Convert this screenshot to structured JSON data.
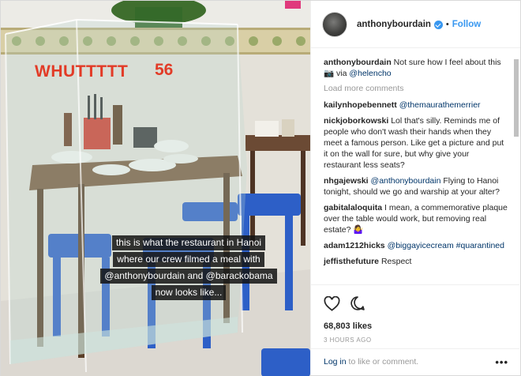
{
  "post": {
    "photo": {
      "overlay_text": "WHUTTTTT",
      "overlay_number": "56",
      "caption_lines": [
        "this is what the restaurant in Hanoi",
        "where our crew filmed a meal with",
        "@anthonybourdain and @barackobama",
        "now looks like..."
      ]
    },
    "header": {
      "username": "anthonybourdain",
      "separator": "•",
      "follow_label": "Follow"
    },
    "caption": {
      "username": "anthonybourdain",
      "text": "Not sure how I feel about this 📷 via ",
      "mention": "@helencho"
    },
    "load_more_label": "Load more comments",
    "comments": [
      {
        "username": "kailynhopebennett",
        "mention": "@themaurathemerrier",
        "text": ""
      },
      {
        "username": "nickjoborkowski",
        "mention": "",
        "text": "Lol that's silly. Reminds me of people who don't wash their hands when they meet a famous person. Like get a picture and put it on the wall for sure, but why give your restaurant less seats?"
      },
      {
        "username": "nhgajewski",
        "mention": "@anthonybourdain",
        "text": "Flying to Hanoi tonight, should we go and warship at your alter?"
      },
      {
        "username": "gabitalaloquita",
        "mention": "",
        "text": "I mean, a commemorative plaque over the table would work, but removing real estate? 🤷‍♀️"
      },
      {
        "username": "adam1212hicks",
        "mention": "@biggayicecream #quarantined",
        "text": ""
      },
      {
        "username": "jeffisthefuture",
        "mention": "",
        "text": "Respect"
      }
    ],
    "likes": "68,803 likes",
    "timestamp": "3 HOURS AGO",
    "login": {
      "link": "Log in",
      "rest": " to like or comment."
    },
    "more_label": "•••",
    "icons": {
      "like": "heart-icon",
      "comment": "comment-icon",
      "verified": "verified-badge-icon",
      "more": "more-options-icon"
    },
    "colors": {
      "link": "#003569",
      "follow": "#3897f0",
      "overlay_red": "#e23b27"
    }
  }
}
